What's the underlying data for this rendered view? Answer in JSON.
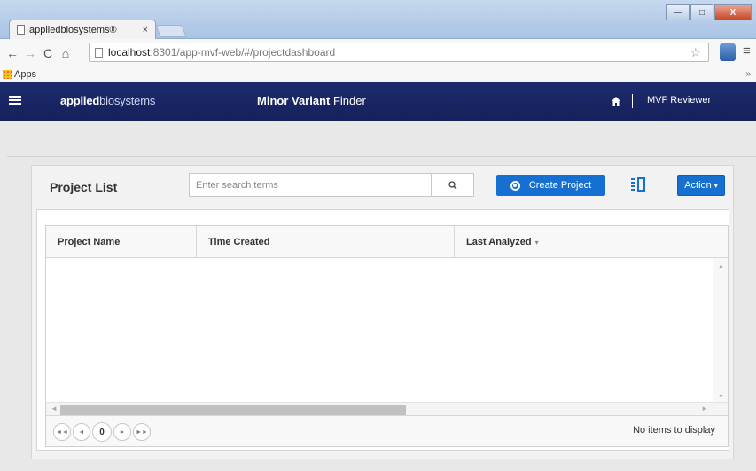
{
  "browser": {
    "tab_title": "appliedbiosystems®",
    "tab_close": "×",
    "url_host": "localhost",
    "url_rest": ":8301/app-mvf-web/#/projectdashboard",
    "bookmarks_apps": "Apps",
    "bookmarks_more": "»",
    "nav_back": "←",
    "nav_forward": "→",
    "nav_reload": "C",
    "nav_home": "⌂",
    "star": "☆",
    "menu": "≡",
    "win_min": "—",
    "win_max": "□",
    "win_close": "X"
  },
  "header": {
    "brand_bold": "applied",
    "brand_light": "biosystems",
    "title_bold": "Minor Variant",
    "title_light": " Finder",
    "user": "MVF Reviewer"
  },
  "project_list": {
    "title": "Project List",
    "search_placeholder": "Enter search terms",
    "create_label": "Create Project",
    "action_label": "Action",
    "action_caret": "▾"
  },
  "grid": {
    "columns": [
      {
        "label": "Project Name"
      },
      {
        "label": "Time Created"
      },
      {
        "label": "Last Analyzed",
        "sort": "▾"
      }
    ],
    "rows": [],
    "pager": {
      "first": "◄◄",
      "prev": "◄",
      "page": "0",
      "next": "►",
      "last": "►►",
      "info": "No items to display"
    }
  },
  "colors": {
    "header_bg": "#1d2b6f",
    "primary_button": "#1670d2",
    "page_bg": "#e8e8e8"
  }
}
